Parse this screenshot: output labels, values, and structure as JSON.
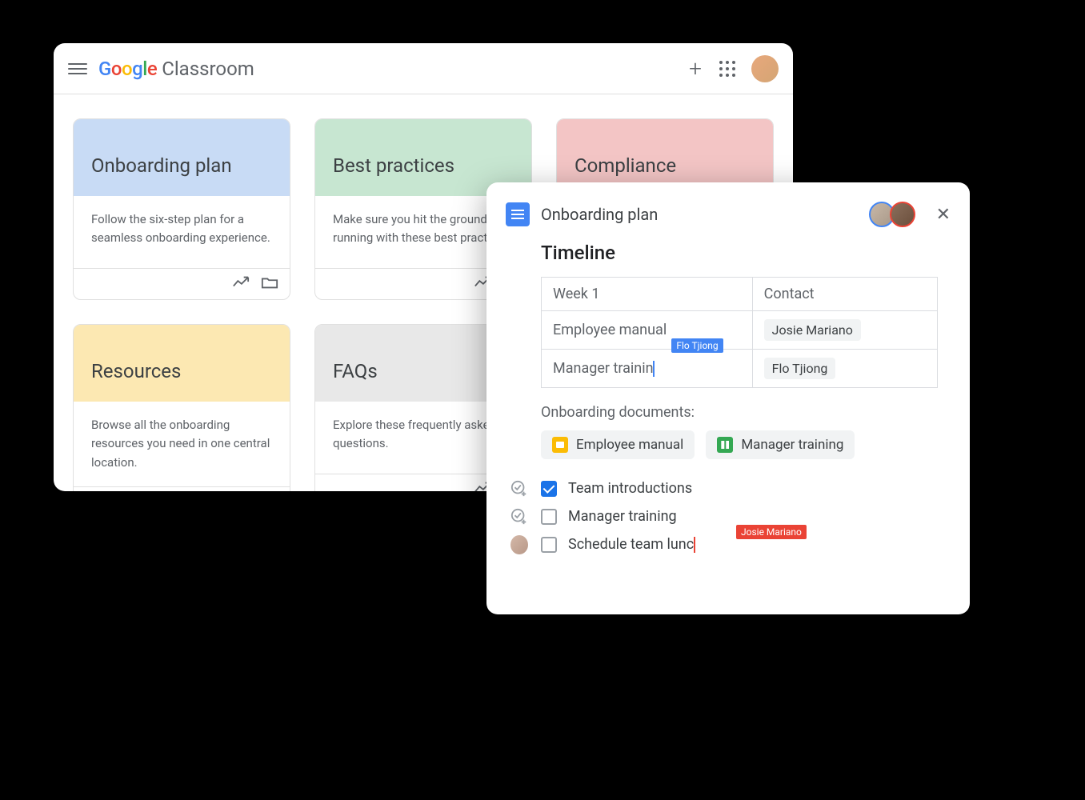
{
  "header": {
    "logo_text": "Google",
    "app_name": "Classroom"
  },
  "cards": [
    {
      "title": "Onboarding plan",
      "desc": "Follow the six-step plan for a seamless onboarding experience.",
      "color": "blue"
    },
    {
      "title": "Best practices",
      "desc": "Make sure you hit the ground running with these best practices.",
      "color": "green"
    },
    {
      "title": "Compliance",
      "desc": "",
      "color": "red"
    },
    {
      "title": "Resources",
      "desc": "Browse all the onboarding resources you need in one central location.",
      "color": "yellow"
    },
    {
      "title": "FAQs",
      "desc": "Explore these frequently asked questions.",
      "color": "grey"
    }
  ],
  "doc": {
    "title": "Onboarding plan",
    "heading": "Timeline",
    "table": {
      "col1_header": "Week 1",
      "col2_header": "Contact",
      "rows": [
        {
          "item": "Employee manual",
          "contact": "Josie Mariano"
        },
        {
          "item": "Manager trainin",
          "contact": "Flo Tjiong"
        }
      ]
    },
    "collab_cursors": {
      "blue_tag": "Flo Tjiong",
      "red_tag": "Josie Mariano"
    },
    "subheading": "Onboarding documents:",
    "doc_chips": [
      {
        "label": "Employee manual",
        "icon": "slides"
      },
      {
        "label": "Manager training",
        "icon": "sheets"
      }
    ],
    "checklist": [
      {
        "text": "Team introductions",
        "checked": true
      },
      {
        "text": "Manager training",
        "checked": false
      },
      {
        "text": "Schedule team lunc",
        "checked": false,
        "red_cursor": true,
        "avatar": true
      }
    ]
  }
}
